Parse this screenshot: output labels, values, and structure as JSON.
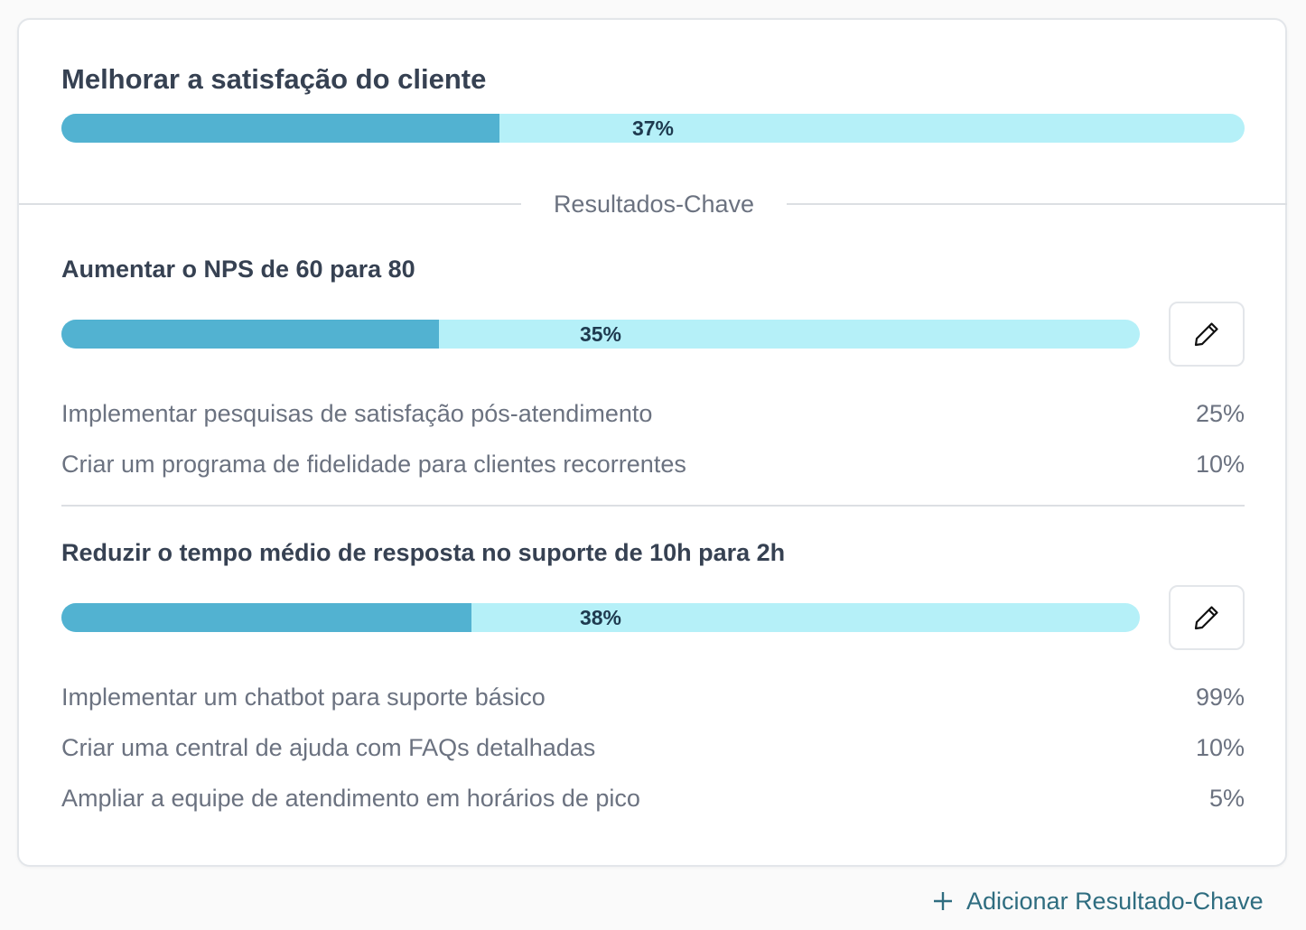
{
  "objective": {
    "title": "Melhorar a satisfação do cliente",
    "progress": 37,
    "progress_label": "37%"
  },
  "divider": {
    "label": "Resultados-Chave"
  },
  "key_results": [
    {
      "title": "Aumentar o NPS de 60 para 80",
      "progress": 35,
      "progress_label": "35%",
      "edit_icon": "pencil-icon",
      "tasks": [
        {
          "name": "Implementar pesquisas de satisfação pós-atendimento",
          "percent": "25%"
        },
        {
          "name": "Criar um programa de fidelidade para clientes recorrentes",
          "percent": "10%"
        }
      ]
    },
    {
      "title": "Reduzir o tempo médio de resposta no suporte de 10h para 2h",
      "progress": 38,
      "progress_label": "38%",
      "edit_icon": "pencil-icon",
      "tasks": [
        {
          "name": "Implementar um chatbot para suporte básico",
          "percent": "99%"
        },
        {
          "name": "Criar uma central de ajuda com FAQs detalhadas",
          "percent": "10%"
        },
        {
          "name": "Ampliar a equipe de atendimento em horários de pico",
          "percent": "5%"
        }
      ]
    }
  ],
  "add_button": {
    "label": "Adicionar Resultado-Chave",
    "icon": "plus-icon"
  },
  "colors": {
    "bar_fill": "#52b2d1",
    "bar_track": "#b5f0f8",
    "title_text": "#364152",
    "muted_text": "#6b7280",
    "link": "#2f6d80"
  }
}
